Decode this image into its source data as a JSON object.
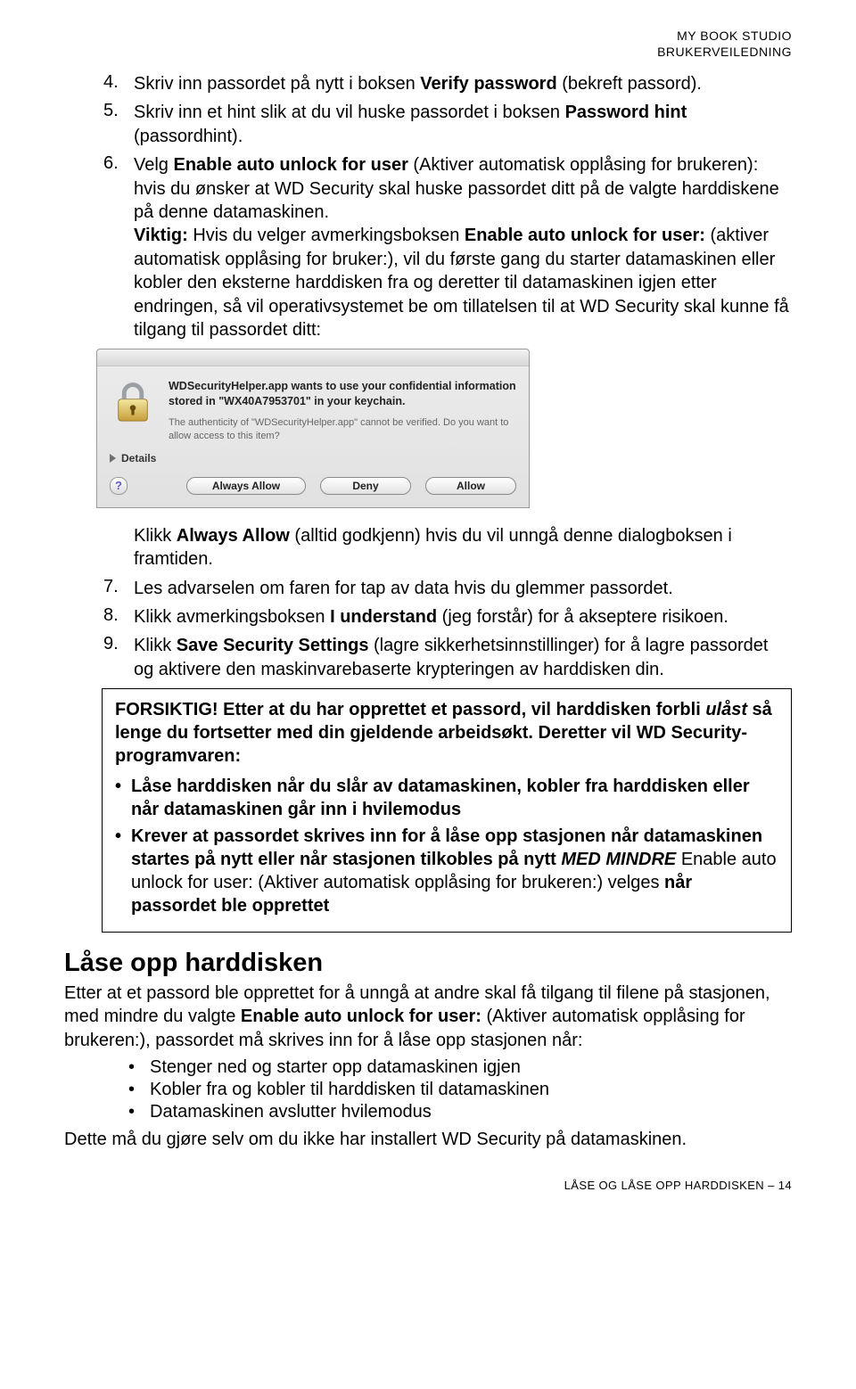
{
  "header": {
    "line1": "MY BOOK STUDIO",
    "line2": "BRUKERVEILEDNING"
  },
  "steps": {
    "s4": {
      "num": "4.",
      "pre": "Skriv inn passordet på nytt i boksen ",
      "bold": "Verify password",
      "post": " (bekreft passord)."
    },
    "s5": {
      "num": "5.",
      "pre": "Skriv inn et hint slik at du vil huske passordet i boksen ",
      "bold": "Password hint",
      "post": " (passordhint)."
    },
    "s6": {
      "num": "6.",
      "pre": "Velg ",
      "bold": "Enable auto unlock for user",
      "post": " (Aktiver automatisk opplåsing for brukeren): hvis du ønsker at WD Security skal huske passordet ditt på de valgte harddiskene på denne datamaskinen.",
      "important_label": "Viktig:",
      "important_pre": " Hvis du velger avmerkingsboksen ",
      "important_bold": "Enable auto unlock for user:",
      "important_post": " (aktiver automatisk opplåsing for bruker:), vil du første gang du starter datamaskinen eller kobler den eksterne harddisken fra og deretter til datamaskinen igjen etter endringen, så vil operativsystemet be om tillatelsen til at WD Security skal kunne få tilgang til passordet ditt:"
    },
    "after_dialog": {
      "pre": "Klikk ",
      "bold": "Always Allow",
      "post": " (alltid godkjenn) hvis du vil unngå denne dialogboksen i framtiden."
    },
    "s7": {
      "num": "7.",
      "text": "Les advarselen om faren for tap av data hvis du glemmer passordet."
    },
    "s8": {
      "num": "8.",
      "pre": "Klikk avmerkingsboksen ",
      "bold": "I understand",
      "post": " (jeg forstår) for å akseptere risikoen."
    },
    "s9": {
      "num": "9.",
      "pre": "Klikk ",
      "bold": "Save Security Settings",
      "post": " (lagre sikkerhetsinnstillinger) for å lagre passordet og aktivere den maskinvarebaserte krypteringen av harddisken din."
    }
  },
  "dialog": {
    "title": "WDSecurityHelper.app wants to use your confidential information stored in \"WX40A7953701\" in your keychain.",
    "subtitle": "The authenticity of \"WDSecurityHelper.app\" cannot be verified. Do you want to allow access to this item?",
    "details": "Details",
    "help": "?",
    "buttons": {
      "always_allow": "Always Allow",
      "deny": "Deny",
      "allow": "Allow"
    }
  },
  "caution": {
    "lead_label": "FORSIKTIG!",
    "lead_text_1": " Etter at du har opprettet et passord, vil harddisken forbli ",
    "lead_italic": "ulåst",
    "lead_text_2": " så lenge du fortsetter med din gjeldende arbeidsøkt. Deretter vil WD Security-programvaren:",
    "b1": "Låse harddisken når du slår av datamaskinen, kobler fra harddisken eller når datamaskinen går inn i hvilemodus",
    "b2_pre": "Krever at passordet skrives inn for å låse opp stasjonen når datamaskinen startes på nytt eller når stasjonen tilkobles på nytt ",
    "b2_ital": "MED MINDRE",
    "b2_mid": " Enable auto unlock for user: (Aktiver automatisk opplåsing for brukeren:) velges ",
    "b2_post": "når passordet ble opprettet"
  },
  "section": {
    "title": "Låse opp harddisken",
    "intro_pre": "Etter at et passord ble opprettet for å unngå at andre skal få tilgang til filene på stasjonen, med mindre du valgte ",
    "intro_bold": "Enable auto unlock for user:",
    "intro_post": " (Aktiver automatisk opplåsing for brukeren:), passordet må skrives inn for å låse opp stasjonen når:",
    "items": {
      "i1": "Stenger ned og starter opp datamaskinen igjen",
      "i2": "Kobler fra og kobler til harddisken til datamaskinen",
      "i3": "Datamaskinen avslutter hvilemodus"
    },
    "outro": "Dette må du gjøre selv om du ikke har installert WD Security på datamaskinen."
  },
  "footer": "LÅSE OG LÅSE OPP HARDDISKEN – 14"
}
